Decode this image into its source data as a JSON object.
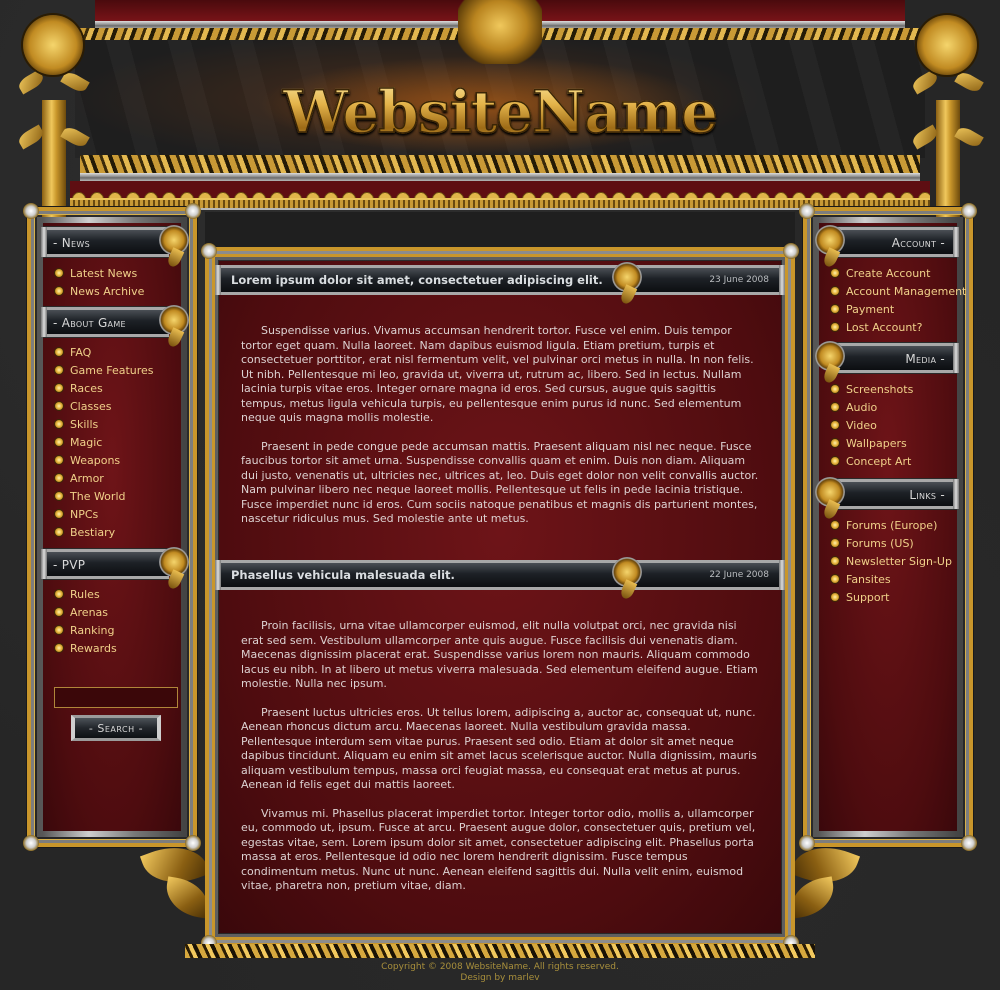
{
  "site": {
    "name": "WebsiteName"
  },
  "left_sidebar": {
    "sections": [
      {
        "title": "- News",
        "items": [
          {
            "label": "Latest News"
          },
          {
            "label": "News Archive"
          }
        ]
      },
      {
        "title": "- About Game",
        "items": [
          {
            "label": "FAQ"
          },
          {
            "label": "Game Features"
          },
          {
            "label": "Races"
          },
          {
            "label": "Classes"
          },
          {
            "label": "Skills"
          },
          {
            "label": "Magic"
          },
          {
            "label": "Weapons"
          },
          {
            "label": "Armor"
          },
          {
            "label": "The World"
          },
          {
            "label": "NPCs"
          },
          {
            "label": "Bestiary"
          }
        ]
      },
      {
        "title": "- PVP",
        "items": [
          {
            "label": "Rules"
          },
          {
            "label": "Arenas"
          },
          {
            "label": "Ranking"
          },
          {
            "label": "Rewards"
          }
        ]
      }
    ],
    "search": {
      "value": "",
      "placeholder": "",
      "button_label": "- Search -"
    }
  },
  "right_sidebar": {
    "sections": [
      {
        "title": "Account -",
        "items": [
          {
            "label": "Create Account"
          },
          {
            "label": "Account Management"
          },
          {
            "label": "Payment"
          },
          {
            "label": "Lost Account?"
          }
        ]
      },
      {
        "title": "Media -",
        "items": [
          {
            "label": "Screenshots"
          },
          {
            "label": "Audio"
          },
          {
            "label": "Video"
          },
          {
            "label": "Wallpapers"
          },
          {
            "label": "Concept Art"
          }
        ]
      },
      {
        "title": "Links -",
        "items": [
          {
            "label": "Forums (Europe)"
          },
          {
            "label": "Forums (US)"
          },
          {
            "label": "Newsletter Sign-Up"
          },
          {
            "label": "Fansites"
          },
          {
            "label": "Support"
          }
        ]
      }
    ]
  },
  "posts": [
    {
      "title": "Lorem ipsum dolor sit amet, consectetuer adipiscing elit.",
      "date": "23 June 2008",
      "paragraphs": [
        "Suspendisse varius. Vivamus accumsan hendrerit tortor. Fusce vel enim. Duis tempor tortor eget quam. Nulla laoreet. Nam dapibus euismod ligula. Etiam pretium, turpis et consectetuer porttitor, erat nisl fermentum velit, vel pulvinar orci metus in nulla. In non felis. Ut nibh. Pellentesque mi leo, gravida ut, viverra ut, rutrum ac, libero. Sed in lectus. Nullam lacinia turpis vitae eros. Integer ornare magna id eros. Sed cursus, augue quis sagittis tempus, metus ligula vehicula turpis, eu pellentesque enim purus id nunc. Sed elementum neque quis magna mollis molestie.",
        "Praesent in pede congue pede accumsan mattis. Praesent aliquam nisl nec neque. Fusce faucibus tortor sit amet urna. Suspendisse convallis quam et enim. Duis non diam. Aliquam dui justo, venenatis ut, ultricies nec, ultrices at, leo. Duis eget dolor non velit convallis auctor. Nam pulvinar libero nec neque laoreet mollis. Pellentesque ut felis in pede lacinia tristique. Fusce imperdiet nunc id eros. Cum sociis natoque penatibus et magnis dis parturient montes, nascetur ridiculus mus. Sed molestie ante ut metus."
      ]
    },
    {
      "title": "Phasellus vehicula malesuada elit.",
      "date": "22 June 2008",
      "paragraphs": [
        "Proin facilisis, urna vitae ullamcorper euismod, elit nulla volutpat orci, nec gravida nisi erat sed sem. Vestibulum ullamcorper ante quis augue. Fusce facilisis dui venenatis diam. Maecenas dignissim placerat erat. Suspendisse varius lorem non mauris. Aliquam commodo lacus eu nibh. In at libero ut metus viverra malesuada. Sed elementum eleifend augue. Etiam molestie. Nulla nec ipsum.",
        "Praesent luctus ultricies eros. Ut tellus lorem, adipiscing a, auctor ac, consequat ut, nunc. Aenean rhoncus dictum arcu. Maecenas laoreet. Nulla vestibulum gravida massa. Pellentesque interdum sem vitae purus. Praesent sed odio. Etiam at dolor sit amet neque dapibus tincidunt. Aliquam eu enim sit amet lacus scelerisque auctor. Nulla dignissim, mauris aliquam vestibulum tempus, massa orci feugiat massa, eu consequat erat metus at purus. Aenean id felis eget dui mattis laoreet.",
        "Vivamus mi. Phasellus placerat imperdiet tortor. Integer tortor odio, mollis a, ullamcorper eu, commodo ut, ipsum. Fusce at arcu. Praesent augue dolor, consectetuer quis, pretium vel, egestas vitae, sem. Lorem ipsum dolor sit amet, consectetuer adipiscing elit. Phasellus porta massa at eros. Pellentesque id odio nec lorem hendrerit dignissim. Fusce tempus condimentum metus. Nunc ut nunc. Aenean eleifend sagittis dui. Nulla velit enim, euismod vitae, pharetra non, pretium vitae, diam."
      ]
    }
  ],
  "footer": {
    "copyright": "Copyright © 2008 WebsiteName. All rights reserved.",
    "credit": "Design by marlev"
  },
  "colors": {
    "link_gold": "#f0d18a",
    "panel_red": "#5a0f12",
    "frame_gold": "#c9962b",
    "body_text": "#ddd2d2",
    "footer_text": "#a88f3c"
  }
}
